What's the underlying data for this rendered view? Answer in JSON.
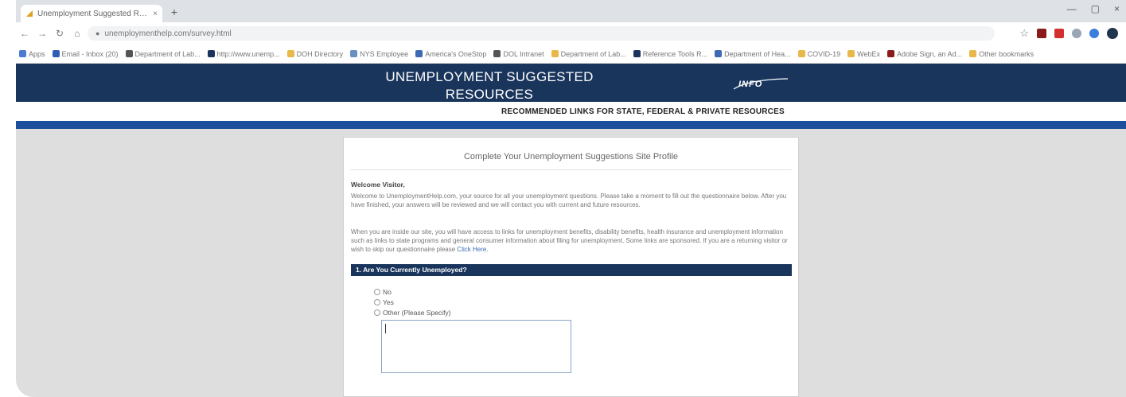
{
  "browser": {
    "tab_title": "Unemployment Suggested Res…",
    "tab_close": "×",
    "new_tab": "+",
    "window_controls": [
      "—",
      "▢",
      "×"
    ],
    "url": "unemploymenthelp.com/survey.html",
    "bookmarks": [
      {
        "label": "Apps",
        "color": "#4a7bd0"
      },
      {
        "label": "Email - Inbox (20)",
        "color": "#2f5fb3"
      },
      {
        "label": "Department of Lab...",
        "color": "#555555"
      },
      {
        "label": "http://www.unemp...",
        "color": "#1a355c"
      },
      {
        "label": "DOH Directory",
        "color": "#e8b84a"
      },
      {
        "label": "NYS Employee",
        "color": "#6a8fc4"
      },
      {
        "label": "America's OneStop",
        "color": "#3d6bb3"
      },
      {
        "label": "DOL Intranet",
        "color": "#555555"
      },
      {
        "label": "Department of Lab...",
        "color": "#e8b84a"
      },
      {
        "label": "Reference Tools R...",
        "color": "#1a355c"
      },
      {
        "label": "Department of Hea...",
        "color": "#3d6bb3"
      },
      {
        "label": "COVID-19",
        "color": "#e8b84a"
      },
      {
        "label": "WebEx",
        "color": "#e8b84a"
      },
      {
        "label": "Adobe Sign, an Ad...",
        "color": "#8b1a1a"
      },
      {
        "label": "Other bookmarks",
        "color": "#e8b84a"
      }
    ]
  },
  "site": {
    "title_line1": "UNEMPLOYMENT SUGGESTED",
    "title_line2": "RESOURCES",
    "logo_text": "INFO",
    "subheader": "RECOMMENDED LINKS FOR STATE, FEDERAL & PRIVATE RESOURCES",
    "header_color": "#1a355c",
    "strip_color": "#1e4f9c"
  },
  "survey": {
    "title": "Complete Your Unemployment Suggestions Site Profile",
    "welcome": "Welcome Visitor,",
    "para1": "Welcome to UnemploymentHelp.com, your source for all your unemployment questions. Please take a moment to fill out the questionnaire below. After you have finished, your answers will be reviewed and we will contact you with current and future resources.",
    "para2": "When you are inside our site, you will have access to links for unemployment benefits, disability benefits, health insurance and unemployment information such as links to state programs and general consumer information about filing for unemployment. Some links are sponsored. If you are a returning visitor or wish to skip our questionnaire please",
    "para2_link": "Click Here.",
    "question": "1. Are You Currently Unemployed?",
    "options": [
      "No",
      "Yes",
      "Other (Please Specify)"
    ],
    "other_value": ""
  }
}
